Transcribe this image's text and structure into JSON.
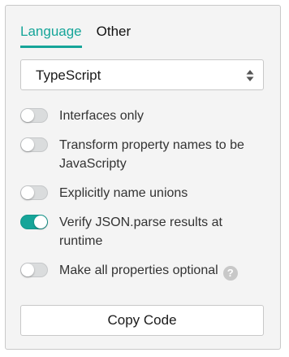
{
  "tabs": [
    {
      "label": "Language",
      "active": true
    },
    {
      "label": "Other",
      "active": false
    }
  ],
  "language_select": {
    "value": "TypeScript",
    "icon": "select-arrows-icon"
  },
  "options": [
    {
      "label": "Interfaces only",
      "enabled": false
    },
    {
      "label": "Transform property names to be JavaScripty",
      "enabled": false
    },
    {
      "label": "Explicitly name unions",
      "enabled": false
    },
    {
      "label": "Verify JSON.parse results at runtime",
      "enabled": true
    },
    {
      "label": "Make all properties optional",
      "enabled": false,
      "help_icon": "?"
    }
  ],
  "copy_button": {
    "label": "Copy Code"
  },
  "colors": {
    "accent": "#16a599",
    "panel_background": "#f4f4f4",
    "toggle_off": "#dadcdd"
  }
}
